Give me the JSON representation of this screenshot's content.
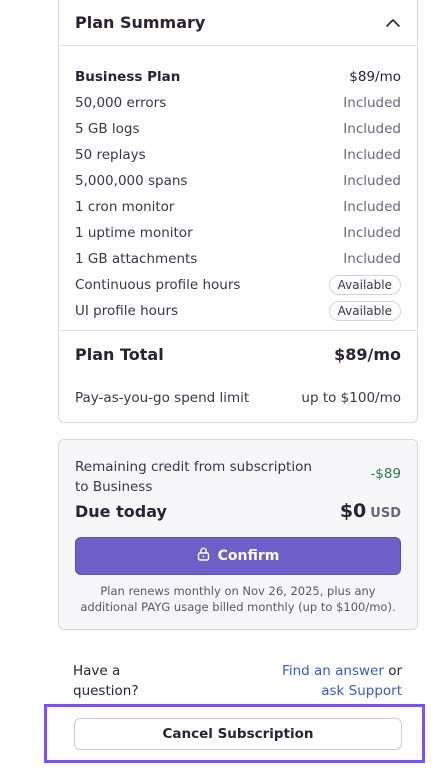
{
  "summary": {
    "title": "Plan Summary",
    "collapse_icon": "chevron-up-icon",
    "items": [
      {
        "name": "Business Plan",
        "value": "$89/mo",
        "kind": "price"
      },
      {
        "name": "50,000 errors",
        "value": "Included",
        "kind": "text"
      },
      {
        "name": "5 GB logs",
        "value": "Included",
        "kind": "text"
      },
      {
        "name": "50 replays",
        "value": "Included",
        "kind": "text"
      },
      {
        "name": "5,000,000 spans",
        "value": "Included",
        "kind": "text"
      },
      {
        "name": "1 cron monitor",
        "value": "Included",
        "kind": "text"
      },
      {
        "name": "1 uptime monitor",
        "value": "Included",
        "kind": "text"
      },
      {
        "name": "1 GB attachments",
        "value": "Included",
        "kind": "text"
      },
      {
        "name": "Continuous profile hours",
        "value": "Available",
        "kind": "pill"
      },
      {
        "name": "UI profile hours",
        "value": "Available",
        "kind": "pill"
      }
    ],
    "total_label": "Plan Total",
    "total_value": "$89/mo",
    "limit_label": "Pay-as-you-go spend limit",
    "limit_value": "up to $100/mo"
  },
  "payment": {
    "credit_label": "Remaining credit from subscription to Business",
    "credit_value": "-$89",
    "credit_color": "#2a7a4e",
    "due_label": "Due today",
    "due_value": "$0",
    "due_currency": "USD",
    "confirm_label": "Confirm",
    "confirm_icon": "lock-icon",
    "accent": "#6c5fc7",
    "renew_note": "Plan renews monthly on Nov 26, 2025, plus any additional PAYG usage billed monthly (up to $100/mo)."
  },
  "help": {
    "question": "Have a question?",
    "find_answer": "Find an answer",
    "or": "or",
    "ask_support": "ask Support"
  },
  "cancel": {
    "label": "Cancel Subscription",
    "highlight_color": "#7d4fff"
  }
}
